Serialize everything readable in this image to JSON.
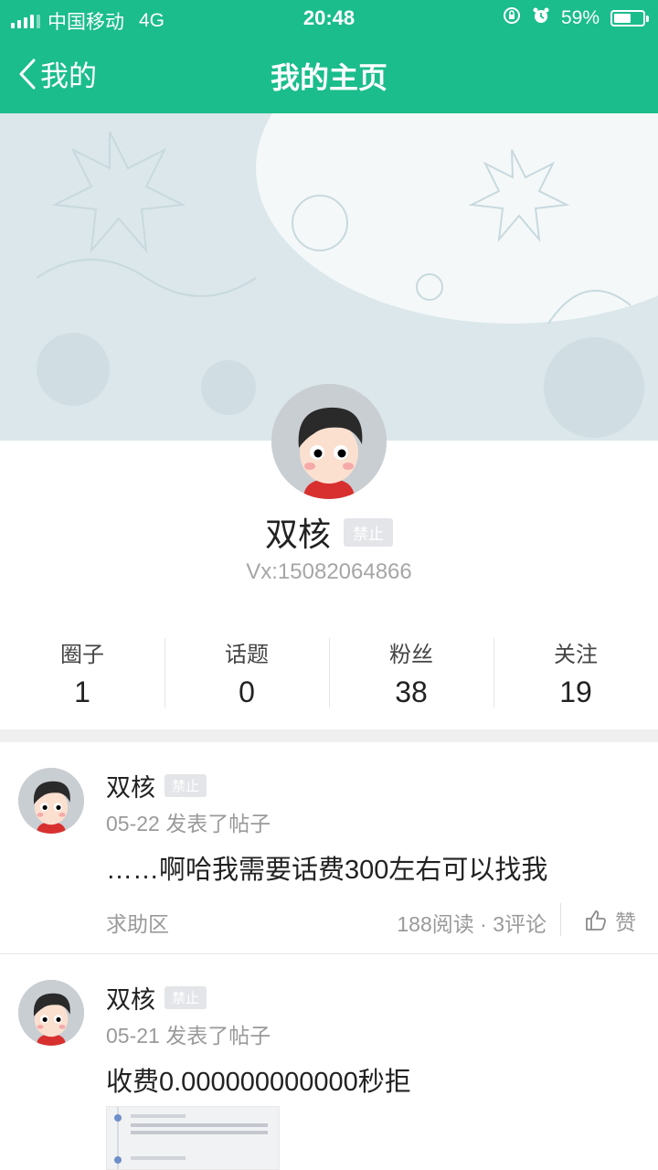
{
  "status": {
    "carrier": "中国移动",
    "network": "4G",
    "time": "20:48",
    "battery": "59%",
    "battery_level": 0.59
  },
  "nav": {
    "back_label": "我的",
    "title": "我的主页"
  },
  "profile": {
    "name": "双核",
    "badge": "禁止",
    "wechat": "Vx:15082064866"
  },
  "stats": [
    {
      "label": "圈子",
      "value": "1"
    },
    {
      "label": "话题",
      "value": "0"
    },
    {
      "label": "粉丝",
      "value": "38"
    },
    {
      "label": "关注",
      "value": "19"
    }
  ],
  "posts": [
    {
      "name": "双核",
      "badge": "禁止",
      "meta": "05-22 发表了帖子",
      "body": "……啊哈我需要话费300左右可以找我",
      "category": "求助区",
      "counts": "188阅读 · 3评论",
      "like_label": "赞"
    },
    {
      "name": "双核",
      "badge": "禁止",
      "meta": "05-21 发表了帖子",
      "body": "收费0.000000000000秒拒"
    }
  ],
  "colors": {
    "accent": "#1bbd8c",
    "cover": "#dbe7ea",
    "badge": "#e3e5e8"
  }
}
